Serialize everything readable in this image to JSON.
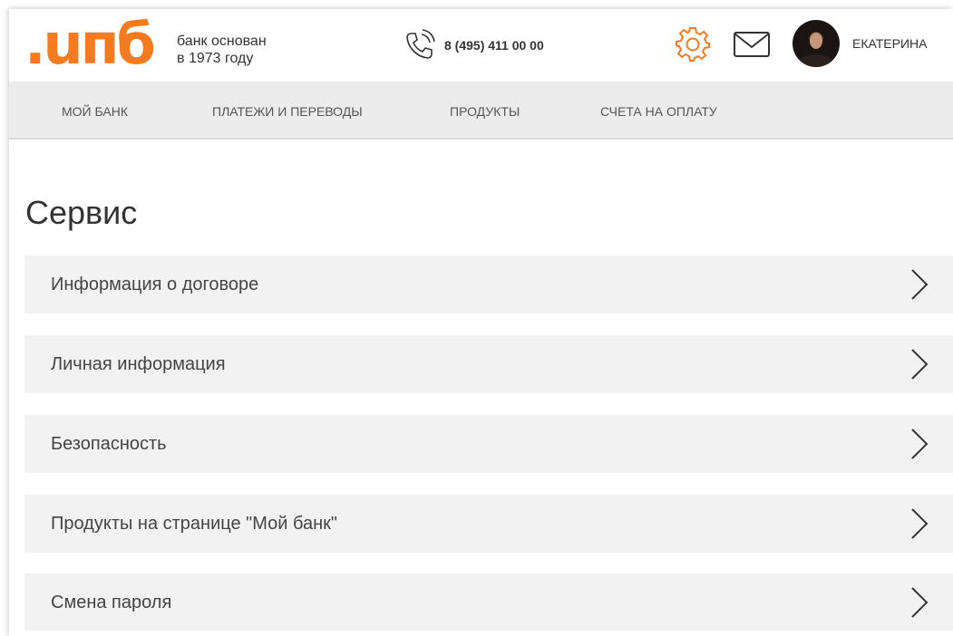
{
  "header": {
    "logo_text": ".uпб",
    "tagline_line1": "банк основан",
    "tagline_line2": "в 1973 году",
    "phone_number": "8 (495) 411 00 00",
    "phone_icon": "phone-icon",
    "settings_icon": "gear-icon",
    "mail_icon": "mail-icon",
    "user_name": "ЕКАТЕРИНА"
  },
  "nav": {
    "items": [
      {
        "label": "МОЙ БАНК"
      },
      {
        "label": "ПЛАТЕЖИ И ПЕРЕВОДЫ"
      },
      {
        "label": "ПРОДУКТЫ"
      },
      {
        "label": "СЧЕТА НА ОПЛАТУ"
      }
    ]
  },
  "main": {
    "title": "Сервис",
    "items": [
      {
        "label": "Информация о договоре"
      },
      {
        "label": "Личная информация"
      },
      {
        "label": "Безопасность"
      },
      {
        "label": "Продукты на странице \"Мой банк\""
      },
      {
        "label": "Смена пароля"
      }
    ]
  },
  "colors": {
    "brand": "#f47b20",
    "nav_bg": "#ececec",
    "row_bg": "#f2f2f2"
  }
}
